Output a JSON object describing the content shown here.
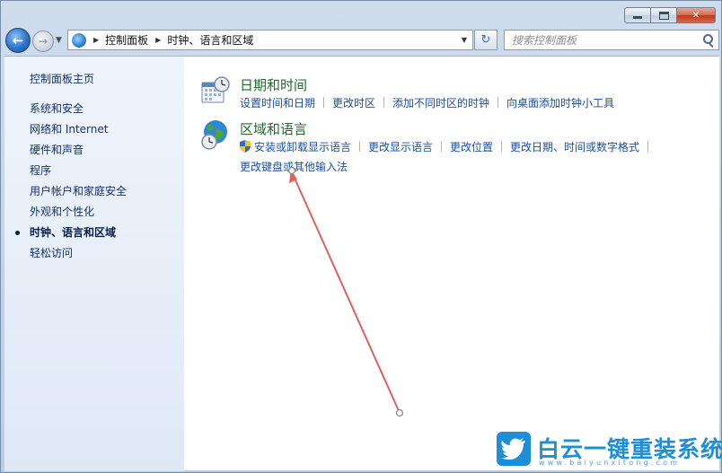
{
  "window": {
    "caption": {
      "minimize": "",
      "maximize": "",
      "close": "✕"
    }
  },
  "navbar": {
    "back_glyph": "←",
    "forward_glyph": "→",
    "breadcrumbs": [
      "控制面板",
      "时钟、语言和区域"
    ],
    "search_placeholder": "搜索控制面板",
    "refresh_glyph": "↻"
  },
  "sidebar": {
    "home": "控制面板主页",
    "items": [
      {
        "label": "系统和安全",
        "active": false
      },
      {
        "label": "网络和 Internet",
        "active": false
      },
      {
        "label": "硬件和声音",
        "active": false
      },
      {
        "label": "程序",
        "active": false
      },
      {
        "label": "用户帐户和家庭安全",
        "active": false
      },
      {
        "label": "外观和个性化",
        "active": false
      },
      {
        "label": "时钟、语言和区域",
        "active": true
      },
      {
        "label": "轻松访问",
        "active": false
      }
    ]
  },
  "categories": [
    {
      "title": "日期和时间",
      "icon": "calendar-clock-icon",
      "links": [
        "设置时间和日期",
        "更改时区",
        "添加不同时区的时钟",
        "向桌面添加时钟小工具"
      ]
    },
    {
      "title": "区域和语言",
      "icon": "globe-clock-icon",
      "links": [
        "安装或卸载显示语言",
        "更改显示语言",
        "更改位置",
        "更改日期、时间或数字格式"
      ],
      "extra_link": "更改键盘或其他输入法"
    }
  ],
  "watermark": {
    "name": "白云一键重装系统",
    "url": "www.baiyunxitong.com"
  },
  "colors": {
    "link": "#1b4f9c",
    "category_title": "#1e6b2c",
    "annotation": "#e06060",
    "watermark": "#1d8ed8"
  }
}
